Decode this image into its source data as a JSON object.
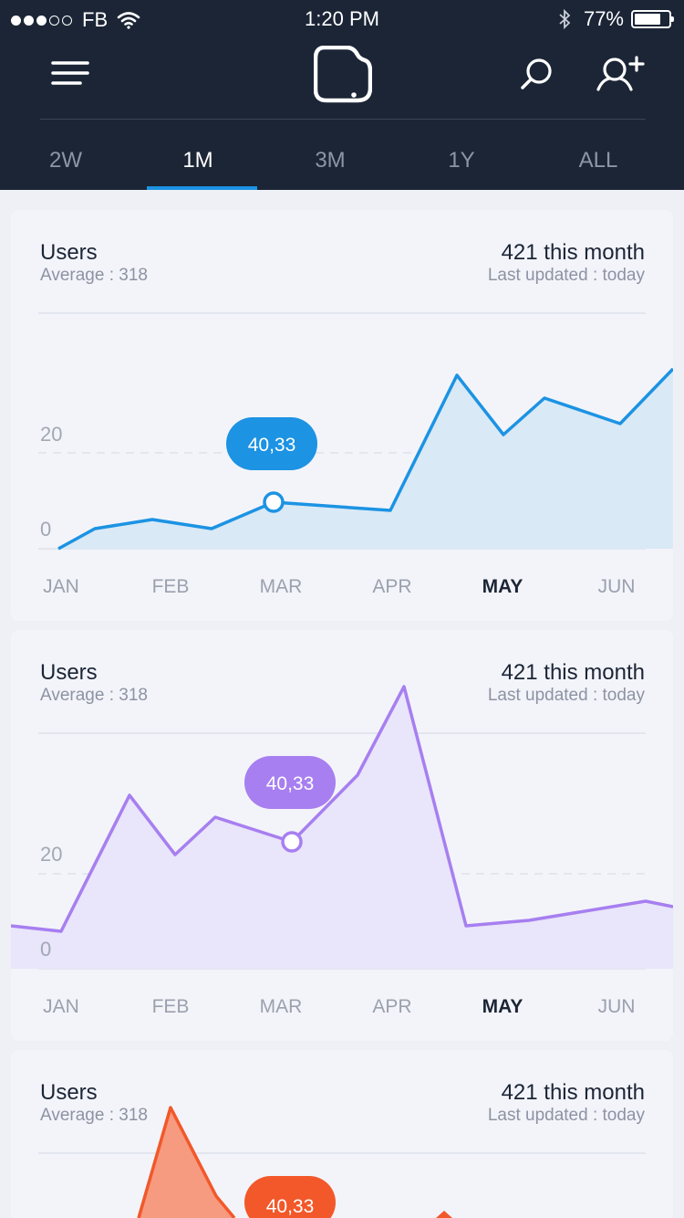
{
  "status_bar": {
    "carrier": "FB",
    "time": "1:20 PM",
    "battery": "77%"
  },
  "header": {
    "icons": [
      "menu-icon",
      "app-logo-icon",
      "search-icon",
      "add-user-icon"
    ]
  },
  "tabs": [
    {
      "label": "2W",
      "active": false
    },
    {
      "label": "1M",
      "active": true
    },
    {
      "label": "3M",
      "active": false
    },
    {
      "label": "1Y",
      "active": false
    },
    {
      "label": "ALL",
      "active": false
    }
  ],
  "cards": [
    {
      "title": "Users",
      "average": "Average : 318",
      "stat": "421 this month",
      "updated": "Last updated : today",
      "tooltip": "40,33",
      "color": "#1c93e3",
      "fill": "#d9e9f6",
      "y_ticks": [
        "20",
        "0"
      ],
      "months": [
        "JAN",
        "FEB",
        "MAR",
        "APR",
        "MAY",
        "JUN"
      ],
      "active_month": "MAY"
    },
    {
      "title": "Users",
      "average": "Average : 318",
      "stat": "421 this month",
      "updated": "Last updated : today",
      "tooltip": "40,33",
      "color": "#a77ff0",
      "fill": "#e9e5fa",
      "y_ticks": [
        "20",
        "0"
      ],
      "months": [
        "JAN",
        "FEB",
        "MAR",
        "APR",
        "MAY",
        "JUN"
      ],
      "active_month": "MAY"
    },
    {
      "title": "Users",
      "average": "Average : 318",
      "stat": "421 this month",
      "updated": "Last updated : today",
      "tooltip": "40,33",
      "color": "#f2582a",
      "fill": "#f69a80"
    }
  ]
}
